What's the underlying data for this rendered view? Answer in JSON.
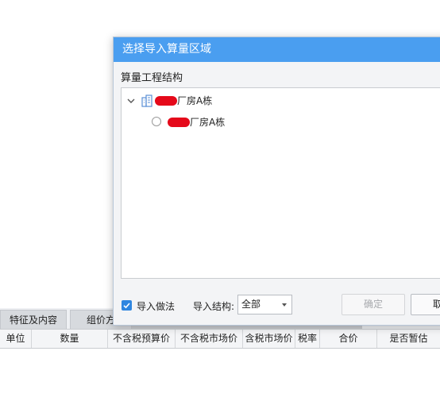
{
  "background": {
    "tabs": [
      "特征及内容",
      "组价方"
    ],
    "columns": [
      "单位",
      "数量",
      "不含税预算价",
      "不含税市场价",
      "含税市场价",
      "税率",
      "合价",
      "是否暂估"
    ]
  },
  "dialog": {
    "title": "选择导入算量区域",
    "section_label": "算量工程结构",
    "tree": {
      "root": {
        "label": "厂房A栋",
        "icon": "building-icon",
        "expanded": true
      },
      "child": {
        "label": "厂房A栋",
        "selected": false
      }
    },
    "import_method_label": "导入做法",
    "import_method_checked": true,
    "import_structure_label": "导入结构:",
    "import_structure_value": "全部",
    "confirm_label": "确定",
    "cancel_label": "取"
  },
  "colors": {
    "title_bar": "#4a9ef0",
    "redaction": "#e5091a",
    "checkbox": "#2f86e0"
  }
}
